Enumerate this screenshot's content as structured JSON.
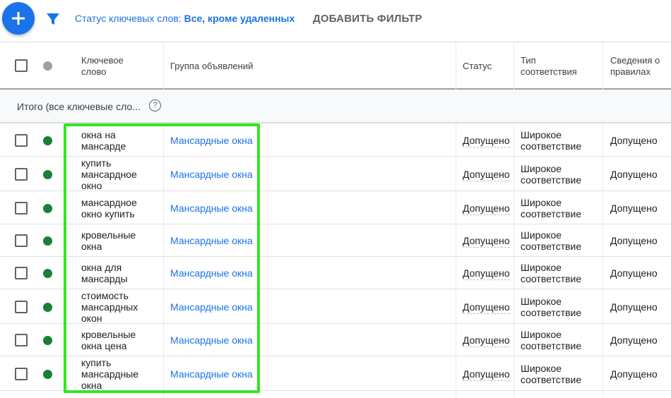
{
  "toolbar": {
    "add_button_icon": "plus-icon",
    "filter_icon": "filter-funnel-icon",
    "filter_label": "Статус ключевых слов: ",
    "filter_value": "Все, кроме удаленных",
    "add_filter_label": "ДОБАВИТЬ ФИЛЬТР"
  },
  "columns": {
    "keyword": [
      "Ключевое",
      "слово"
    ],
    "ad_group": "Группа объявлений",
    "status": "Статус",
    "match_type": [
      "Тип",
      "соответствия"
    ],
    "policy": [
      "Сведения о",
      "правилах"
    ]
  },
  "total_row": {
    "label": "Итого (все ключевые сло...",
    "help_icon": "?"
  },
  "colors": {
    "accent": "#1a73e8",
    "enabled_dot": "#188038",
    "header_dot": "#9aa0a6",
    "highlight": "#33e61f"
  },
  "rows": [
    {
      "keyword": [
        "окна на",
        "мансарде"
      ],
      "ad_group": "Мансардные окна",
      "status": "Допущено",
      "match_type": [
        "Широкое",
        "соответствие"
      ],
      "policy": "Допущено"
    },
    {
      "keyword": [
        "купить",
        "мансардное",
        "окно"
      ],
      "ad_group": "Мансардные окна",
      "status": "Допущено",
      "match_type": [
        "Широкое",
        "соответствие"
      ],
      "policy": "Допущено"
    },
    {
      "keyword": [
        "мансардное",
        "окно купить"
      ],
      "ad_group": "Мансардные окна",
      "status": "Допущено",
      "match_type": [
        "Широкое",
        "соответствие"
      ],
      "policy": "Допущено"
    },
    {
      "keyword": [
        "кровельные",
        "окна"
      ],
      "ad_group": "Мансардные окна",
      "status": "Допущено",
      "match_type": [
        "Широкое",
        "соответствие"
      ],
      "policy": "Допущено"
    },
    {
      "keyword": [
        "окна для",
        "мансарды"
      ],
      "ad_group": "Мансардные окна",
      "status": "Допущено",
      "match_type": [
        "Широкое",
        "соответствие"
      ],
      "policy": "Допущено"
    },
    {
      "keyword": [
        "стоимость",
        "мансардных",
        "окон"
      ],
      "ad_group": "Мансардные окна",
      "status": "Допущено",
      "match_type": [
        "Широкое",
        "соответствие"
      ],
      "policy": "Допущено"
    },
    {
      "keyword": [
        "кровельные",
        "окна цена"
      ],
      "ad_group": "Мансардные окна",
      "status": "Допущено",
      "match_type": [
        "Широкое",
        "соответствие"
      ],
      "policy": "Допущено"
    },
    {
      "keyword": [
        "купить",
        "мансардные",
        "окна"
      ],
      "ad_group": "Мансардные окна",
      "status": "Допущено",
      "match_type": [
        "Широкое",
        "соответствие"
      ],
      "policy": "Допущено"
    }
  ]
}
